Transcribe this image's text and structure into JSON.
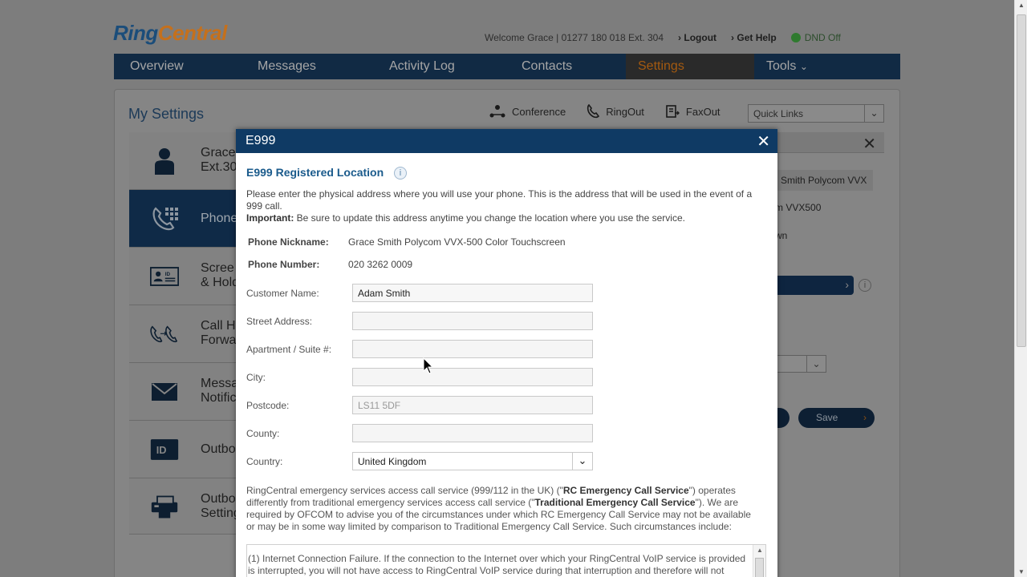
{
  "brand": {
    "part1": "Ring",
    "part2": "Central"
  },
  "topbar": {
    "welcome": "Welcome Grace | 01277 180 018 Ext. 304",
    "logout": "Logout",
    "get_help": "Get Help",
    "dnd": "DND Off"
  },
  "nav": {
    "tabs": [
      {
        "label": "Overview"
      },
      {
        "label": "Messages"
      },
      {
        "label": "Activity Log"
      },
      {
        "label": "Contacts"
      },
      {
        "label": "Settings",
        "active": true
      },
      {
        "label": "Tools"
      }
    ]
  },
  "settings_page": {
    "title": "My Settings",
    "quick_actions": [
      {
        "label": "Conference",
        "icon": "conference-icon"
      },
      {
        "label": "RingOut",
        "icon": "phone-icon"
      },
      {
        "label": "FaxOut",
        "icon": "fax-icon"
      }
    ],
    "quick_links_placeholder": "Quick Links",
    "sidebar": [
      {
        "label": "Grace\nExt.30",
        "icon": "user-icon"
      },
      {
        "label": "Phone",
        "icon": "phone-keypad-icon",
        "active": true
      },
      {
        "label": "Scree\n& Hold",
        "icon": "id-card-icon"
      },
      {
        "label": "Call H\nForwa",
        "icon": "call-forward-icon"
      },
      {
        "label": "Messa\nNotific",
        "icon": "envelope-icon"
      },
      {
        "label": "Outbo",
        "icon": "id-badge-icon"
      },
      {
        "label": "Outbo\nSetting",
        "icon": "fax-machine-icon"
      }
    ],
    "right_panel": {
      "device_chip": "Smith Polycom VVX",
      "model": "m VVX500",
      "status": "wn",
      "save_label": "Save"
    }
  },
  "modal": {
    "title": "E999",
    "heading": "E999 Registered Location",
    "intro": "Please enter the physical address where you will use your phone. This is the address that will be used in the event of a 999 call.",
    "important_label": "Important:",
    "important_text": " Be sure to update this address anytime you change the location where you use the service.",
    "phone_nickname_label": "Phone Nickname:",
    "phone_nickname": "Grace Smith Polycom VVX-500 Color Touchscreen",
    "phone_number_label": "Phone Number:",
    "phone_number": "020 3262 0009",
    "fields": {
      "customer_name": {
        "label": "Customer Name:",
        "value": "Adam Smith"
      },
      "street": {
        "label": "Street Address:",
        "value": ""
      },
      "apartment": {
        "label": "Apartment / Suite #:",
        "value": ""
      },
      "city": {
        "label": "City:",
        "value": ""
      },
      "postcode": {
        "label": "Postcode:",
        "value": "LS11 5DF"
      },
      "county": {
        "label": "County:",
        "value": ""
      },
      "country": {
        "label": "Country:",
        "value": "United Kingdom"
      }
    },
    "disclaimer": {
      "p1": "RingCentral emergency services access call service (999/112 in the UK) (\"",
      "b1": "RC Emergency Call Service",
      "p2": "\") operates differently from traditional emergency services access call service (\"",
      "b2": "Traditional Emergency Call Service",
      "p3": "\"). We are required by OFCOM to advise you of the circumstances under which RC Emergency Call Service may not be available or may be in some way limited by comparison to Traditional Emergency Call Service. Such circumstances include:"
    },
    "terms_text": "(1) Internet Connection Failure. If the connection to the Internet over which your RingCentral VoIP service is provided is interrupted, you will not have access to RingCentral VoIP service during that interruption and therefore will not"
  }
}
